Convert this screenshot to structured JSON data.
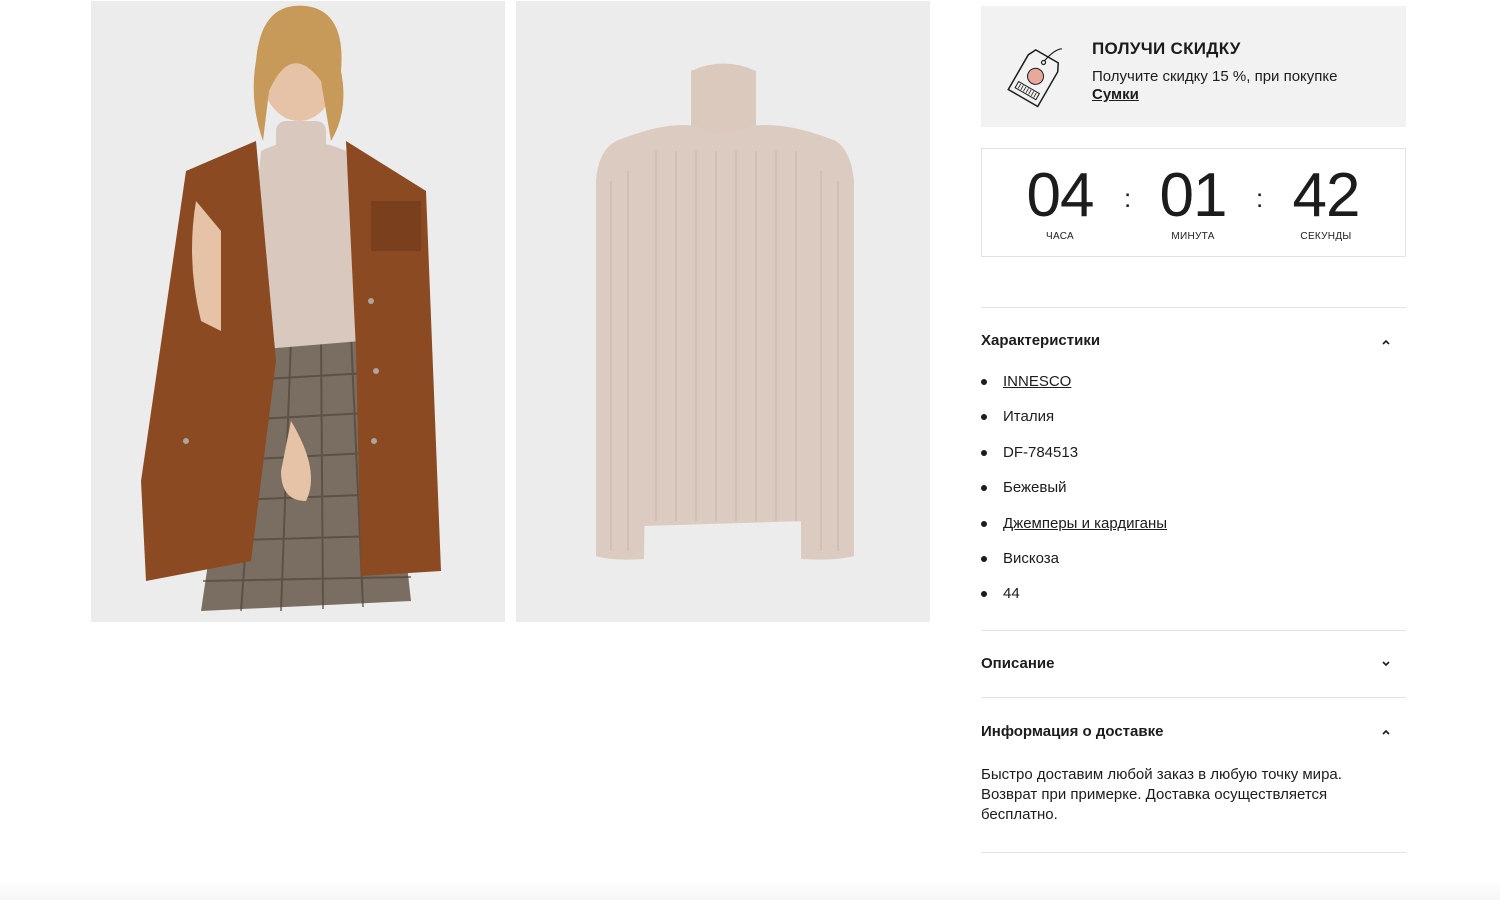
{
  "gallery": {
    "images": [
      {
        "alt": "model-wearing-turtleneck"
      },
      {
        "alt": "beige-turtleneck-sweater"
      }
    ]
  },
  "promo": {
    "title": "ПОЛУЧИ СКИДКУ",
    "text": "Получите скидку 15 %, при покупке",
    "link": "Сумки",
    "icon": "discount-tag-icon"
  },
  "timer": {
    "hours": "04",
    "hours_label": "ЧАСА",
    "minutes": "01",
    "minutes_label": "МИНУТА",
    "seconds": "42",
    "seconds_label": "СЕКУНДЫ",
    "separator": ":"
  },
  "accordion": {
    "characteristics": {
      "title": "Характеристики",
      "expanded": true,
      "items": [
        "INNESCO",
        "Италия",
        "DF-784513",
        "Бежевый",
        "Джемперы и кардиганы",
        "Вискоза",
        "44"
      ]
    },
    "description": {
      "title": "Описание",
      "expanded": false
    },
    "delivery": {
      "title": "Информация о доставке",
      "expanded": true,
      "text": "Быстро доставим любой заказ в любую точку мира. Возврат при примерке. Доставка осуществляется бесплатно."
    }
  },
  "colors": {
    "text": "#1c1c1c",
    "promo_bg": "#f2f2f2",
    "photo_bg": "#ececec",
    "sweater": "#dccbc0",
    "coat": "#8b4a22",
    "tag_accent": "#e8a89a"
  }
}
